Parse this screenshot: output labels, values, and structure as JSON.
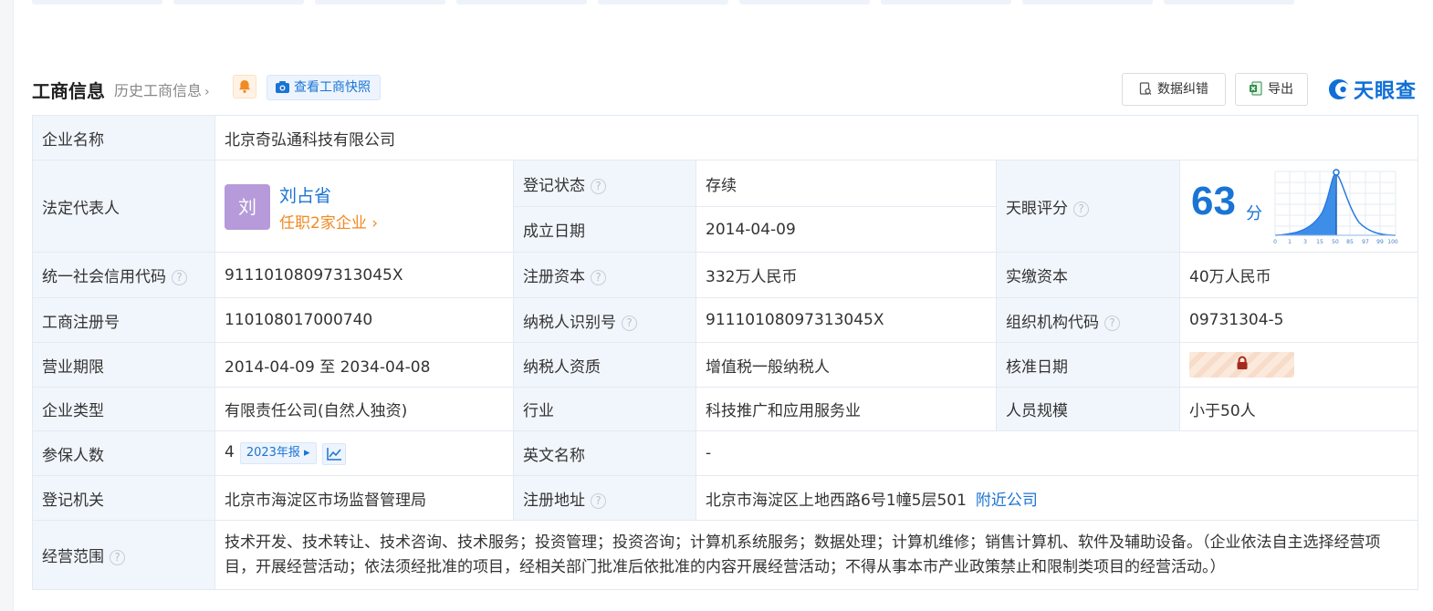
{
  "section": {
    "title": "工商信息",
    "history_link": "历史工商信息",
    "snapshot_button": "查看工商快照",
    "correct_button": "数据纠错",
    "export_button": "导出",
    "logo_text": "天眼查"
  },
  "company": {
    "name_label": "企业名称",
    "name": "北京奇弘通科技有限公司"
  },
  "legal_rep": {
    "label": "法定代表人",
    "avatar_char": "刘",
    "name": "刘占省",
    "positions": "任职2家企业"
  },
  "registration_status": {
    "label": "登记状态",
    "value": "存续"
  },
  "established": {
    "label": "成立日期",
    "value": "2014-04-09"
  },
  "tianyan_score": {
    "label": "天眼评分",
    "score": "63",
    "unit": "分",
    "axis_ticks": [
      "0",
      "1",
      "3",
      "15",
      "50",
      "85",
      "97",
      "99",
      "100"
    ]
  },
  "credit_code": {
    "label": "统一社会信用代码",
    "value": "91110108097313045X"
  },
  "registered_capital": {
    "label": "注册资本",
    "value": "332万人民币"
  },
  "paid_capital": {
    "label": "实缴资本",
    "value": "40万人民币"
  },
  "reg_number": {
    "label": "工商注册号",
    "value": "110108017000740"
  },
  "taxpayer_id": {
    "label": "纳税人识别号",
    "value": "91110108097313045X"
  },
  "org_code": {
    "label": "组织机构代码",
    "value": "09731304-5"
  },
  "business_term": {
    "label": "营业期限",
    "value": "2014-04-09 至 2034-04-08"
  },
  "taxpayer_qualification": {
    "label": "纳税人资质",
    "value": "增值税一般纳税人"
  },
  "approval_date": {
    "label": "核准日期"
  },
  "company_type": {
    "label": "企业类型",
    "value": "有限责任公司(自然人独资)"
  },
  "industry": {
    "label": "行业",
    "value": "科技推广和应用服务业"
  },
  "staff_size": {
    "label": "人员规模",
    "value": "小于50人"
  },
  "insured": {
    "label": "参保人数",
    "value": "4",
    "annual_report": "2023年报"
  },
  "english_name": {
    "label": "英文名称",
    "value": "-"
  },
  "registration_authority": {
    "label": "登记机关",
    "value": "北京市海淀区市场监督管理局"
  },
  "registered_address": {
    "label": "注册地址",
    "value": "北京市海淀区上地西路6号1幢5层501",
    "nearby_link": "附近公司"
  },
  "business_scope": {
    "label": "经营范围",
    "value": "技术开发、技术转让、技术咨询、技术服务；投资管理；投资咨询；计算机系统服务；数据处理；计算机维修；销售计算机、软件及辅助设备。（企业依法自主选择经营项目，开展经营活动；依法须经批准的项目，经相关部门批准后依批准的内容开展经营活动；不得从事本市产业政策禁止和限制类项目的经营活动。）"
  },
  "colors": {
    "accent": "#1a74d4",
    "label_bg": "#f1f6fc",
    "status_green": "#2d9e3e",
    "orange": "#f08a24"
  }
}
